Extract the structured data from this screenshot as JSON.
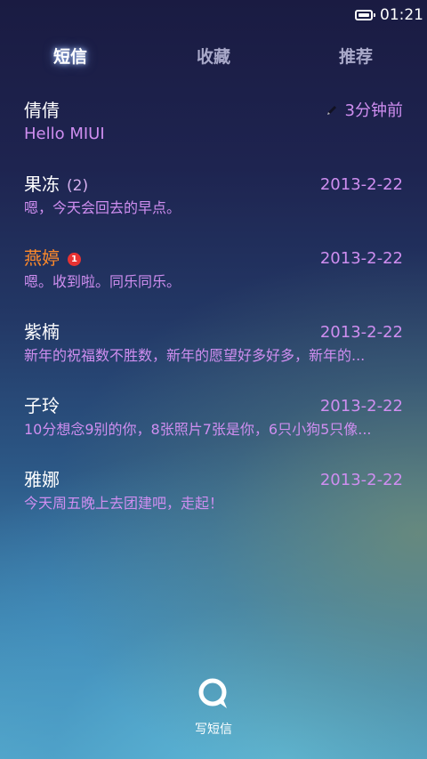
{
  "status_bar": {
    "time": "01:21",
    "battery_icon": "battery-full-icon"
  },
  "tabs": [
    {
      "label": "短信",
      "active": true
    },
    {
      "label": "收藏",
      "active": false
    },
    {
      "label": "推荐",
      "active": false
    }
  ],
  "conversations": [
    {
      "name": "倩倩",
      "count": "",
      "unread": "",
      "time": "3分钟前",
      "draft": true,
      "preview": "Hello MIUI",
      "highlight": false
    },
    {
      "name": "果冻",
      "count": "(2)",
      "unread": "",
      "time": "2013-2-22",
      "draft": false,
      "preview": "嗯，今天会回去的早点。",
      "highlight": false
    },
    {
      "name": "燕婷",
      "count": "",
      "unread": "1",
      "time": "2013-2-22",
      "draft": false,
      "preview": "嗯。收到啦。同乐同乐。",
      "highlight": true
    },
    {
      "name": "紫楠",
      "count": "",
      "unread": "",
      "time": "2013-2-22",
      "draft": false,
      "preview": "新年的祝福数不胜数，新年的愿望好多好多，新年的...",
      "highlight": false
    },
    {
      "name": "子玲",
      "count": "",
      "unread": "",
      "time": "2013-2-22",
      "draft": false,
      "preview": "10分想念9别的你，8张照片7张是你，6只小狗5只像...",
      "highlight": false
    },
    {
      "name": "雅娜",
      "count": "",
      "unread": "",
      "time": "2013-2-22",
      "draft": false,
      "preview": "今天周五晚上去团建吧，走起！",
      "highlight": false
    }
  ],
  "compose": {
    "label": "写短信",
    "icon": "chat-bubble-icon"
  },
  "colors": {
    "accent_text": "#cf8ef0",
    "highlight_name": "#ff8a2a",
    "badge": "#e83232"
  }
}
